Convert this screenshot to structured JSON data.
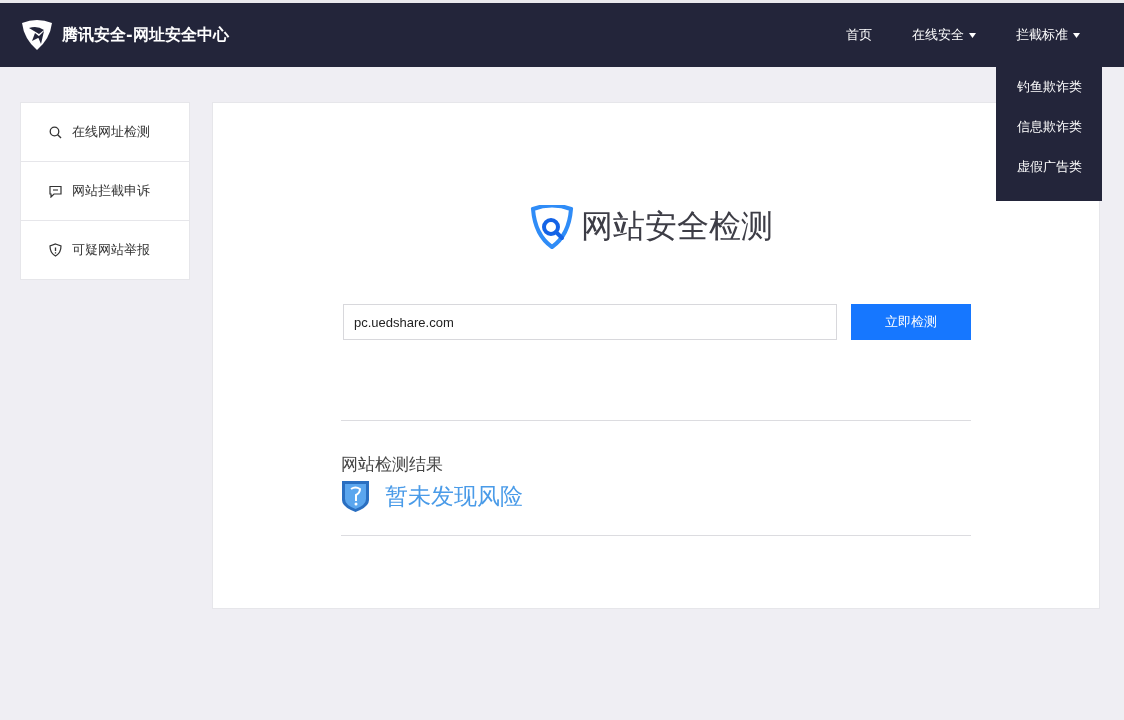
{
  "header": {
    "title": "腾讯安全-网址安全中心"
  },
  "nav": [
    {
      "label": "首页",
      "has_menu": false
    },
    {
      "label": "在线安全",
      "has_menu": true
    },
    {
      "label": "拦截标准",
      "has_menu": true,
      "menu": [
        "钓鱼欺诈类",
        "信息欺诈类",
        "虚假广告类"
      ]
    }
  ],
  "sidebar": {
    "items": [
      {
        "label": "在线网址检测"
      },
      {
        "label": "网站拦截申诉"
      },
      {
        "label": "可疑网站举报"
      }
    ]
  },
  "main": {
    "title": "网站安全检测",
    "url_field": {
      "value": "pc.uedshare.com"
    },
    "check_button": "立即检测",
    "result_label": "网站检测结果",
    "result": "暂未发现风险"
  }
}
